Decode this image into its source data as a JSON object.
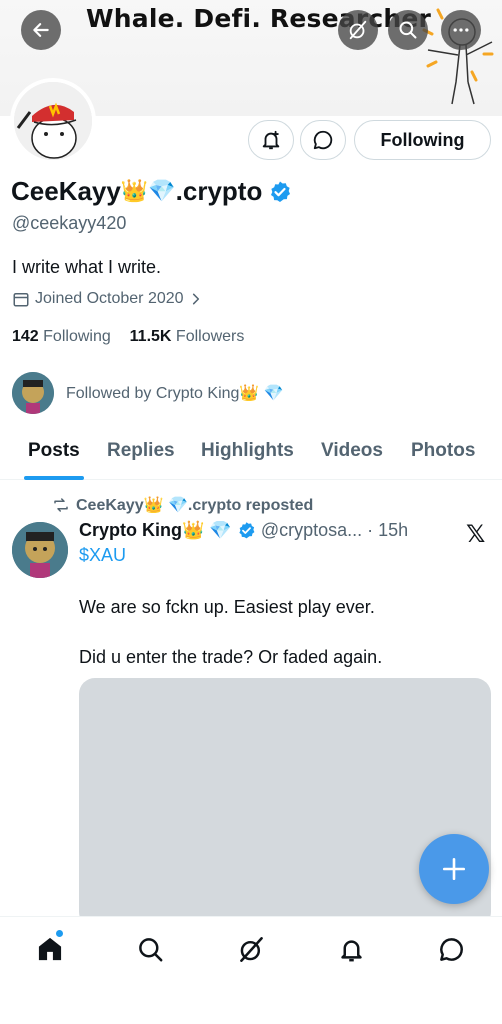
{
  "banner": {
    "title": "Whale. Defi. Researcher",
    "back_icon": "arrow-left-icon",
    "grok_icon": "grok-icon",
    "search_icon": "search-icon",
    "more_icon": "more-horizontal-icon"
  },
  "profile": {
    "display_name": "CeeKayy",
    "name_emojis": "👑💎",
    "name_suffix": ".crypto",
    "handle": "@ceekayy420",
    "bio": "I write what I write.",
    "joined": "Joined October 2020",
    "following_count": "142",
    "following_label": "Following",
    "followers_count": "11.5K",
    "followers_label": "Followers",
    "followed_by": "Followed by Crypto King👑 💎",
    "follow_button": "Following",
    "verified_color": "#1d9bf0"
  },
  "tabs": [
    {
      "label": "Posts",
      "active": true
    },
    {
      "label": "Replies",
      "active": false
    },
    {
      "label": "Highlights",
      "active": false
    },
    {
      "label": "Videos",
      "active": false
    },
    {
      "label": "Photos",
      "active": false
    }
  ],
  "post": {
    "repost_text": "CeeKayy👑 💎.crypto reposted",
    "author_name": "Crypto King👑 💎",
    "author_handle": "@cryptosa...",
    "time": "· 15h",
    "cashtag": "$XAU",
    "line1": "We are so fckn up. Easiest play ever.",
    "line2": "Did u enter the trade? Or faded again.",
    "source_icon": "x-logo-icon"
  },
  "fab_icon": "plus-icon",
  "nav": [
    "home-icon",
    "search-icon",
    "grok-icon",
    "bell-icon",
    "messages-icon"
  ],
  "colors": {
    "accent": "#1d9bf0",
    "fab": "#4a99e9",
    "secondary_text": "#536471"
  }
}
